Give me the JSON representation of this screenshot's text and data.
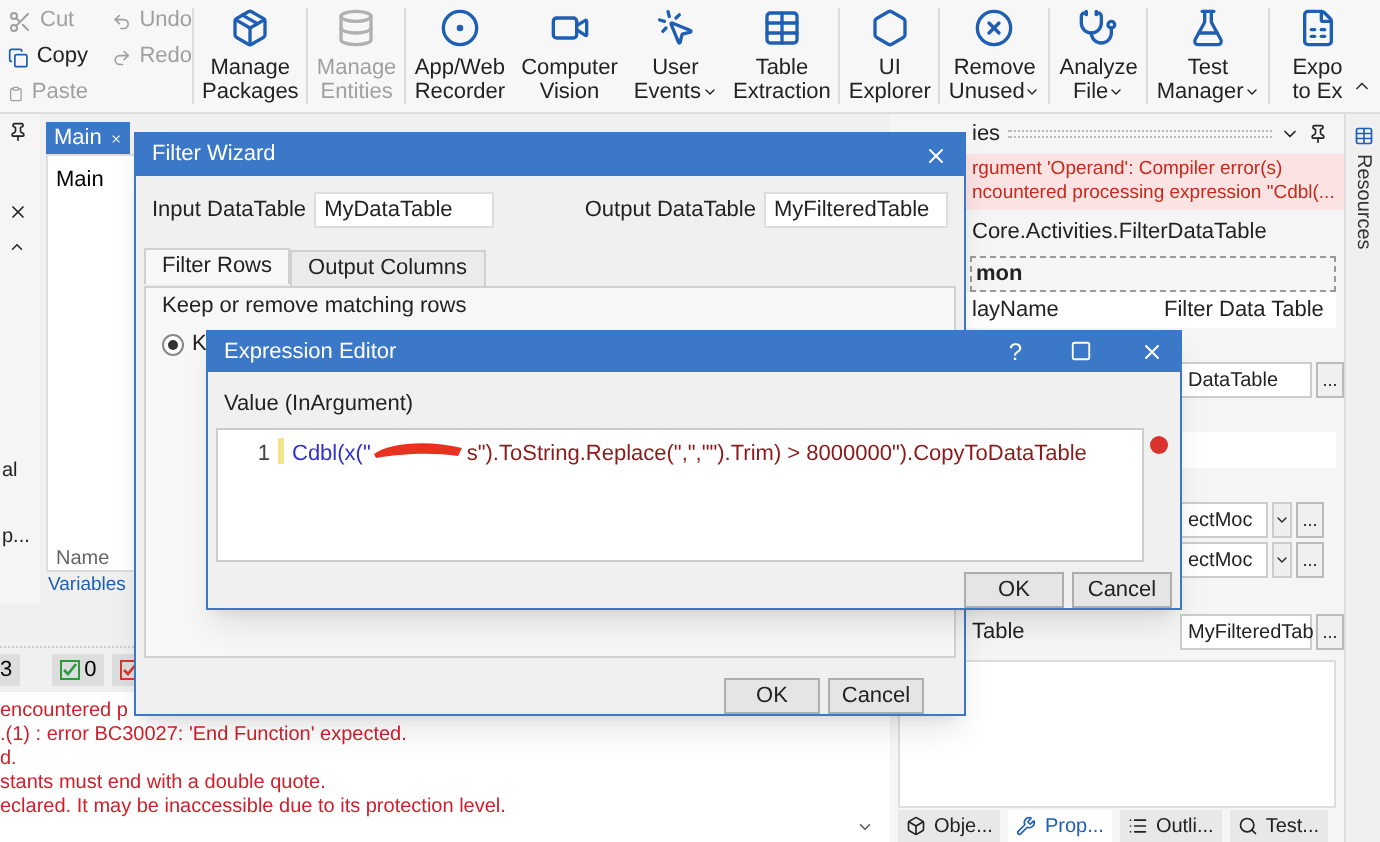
{
  "ribbon": {
    "clipboard": [
      {
        "kind": "cut",
        "label": "Cut",
        "disabled": true
      },
      {
        "kind": "undo",
        "label": "Undo",
        "disabled": true
      },
      {
        "kind": "copy",
        "label": "Copy",
        "disabled": false
      },
      {
        "kind": "redo",
        "label": "Redo",
        "disabled": true
      },
      {
        "kind": "paste",
        "label": "Paste",
        "disabled": true
      }
    ],
    "buttons": [
      {
        "kind": "packages",
        "lines": [
          "Manage",
          "Packages"
        ],
        "disabled": false,
        "dropdown": false
      },
      {
        "kind": "entities",
        "lines": [
          "Manage",
          "Entities"
        ],
        "disabled": true,
        "dropdown": false
      },
      {
        "kind": "recorder",
        "lines": [
          "App/Web",
          "Recorder"
        ],
        "disabled": false,
        "dropdown": false
      },
      {
        "kind": "vision",
        "lines": [
          "Computer",
          "Vision"
        ],
        "disabled": false,
        "dropdown": false
      },
      {
        "kind": "events",
        "lines": [
          "User",
          "Events"
        ],
        "disabled": false,
        "dropdown": true
      },
      {
        "kind": "table",
        "lines": [
          "Table",
          "Extraction"
        ],
        "disabled": false,
        "dropdown": false
      },
      {
        "kind": "explorer",
        "lines": [
          "UI",
          "Explorer"
        ],
        "disabled": false,
        "dropdown": false
      },
      {
        "kind": "remove",
        "lines": [
          "Remove",
          "Unused"
        ],
        "disabled": false,
        "dropdown": true
      },
      {
        "kind": "analyze",
        "lines": [
          "Analyze",
          "File"
        ],
        "disabled": false,
        "dropdown": true
      },
      {
        "kind": "test",
        "lines": [
          "Test",
          "Manager"
        ],
        "disabled": false,
        "dropdown": true
      },
      {
        "kind": "export",
        "lines": [
          "Expo",
          "to Ex"
        ],
        "disabled": false,
        "dropdown": false
      }
    ]
  },
  "left_panel": {
    "texts": [
      "al",
      "p..."
    ]
  },
  "document": {
    "tab": {
      "label": "Main",
      "selected": true
    },
    "breadcrumb": "Main",
    "variables_header": "Name",
    "bottom_link": "Variables"
  },
  "output": {
    "counts": [
      {
        "kind": "plain",
        "label": "3"
      },
      {
        "kind": "success",
        "label": "0"
      },
      {
        "kind": "failure"
      }
    ],
    "lines": [
      "encountered p",
      ".(1) : error BC30027: 'End Function' expected.",
      "d.",
      "stants must end with a double quote.",
      "eclared. It may be inaccessible due to its protection level."
    ]
  },
  "properties": {
    "header": "ies",
    "error_lines": [
      "rgument 'Operand': Compiler error(s)",
      "ncountered processing expression \"Cdbl(..."
    ],
    "activity_type": "Core.Activities.FilterDataTable",
    "category": "mon",
    "rows": [
      {
        "kind": "text",
        "name": "layName",
        "value": "Filter Data Table"
      },
      {
        "kind": "section"
      },
      {
        "kind": "field",
        "value": "DataTable",
        "ellipsis": "..."
      },
      {
        "kind": "section"
      },
      {
        "kind": "blank"
      },
      {
        "kind": "section"
      },
      {
        "kind": "dropdown",
        "value": "ectMoc",
        "ellipsis": "..."
      },
      {
        "kind": "dropdown",
        "value": "ectMoc",
        "ellipsis": "..."
      },
      {
        "kind": "section"
      },
      {
        "kind": "field",
        "name": "Table",
        "value": "MyFilteredTab",
        "ellipsis": "..."
      }
    ],
    "tabs": [
      {
        "kind": "objects",
        "label": "Obje...",
        "selected": false
      },
      {
        "kind": "properties",
        "label": "Prop...",
        "selected": true
      },
      {
        "kind": "outline",
        "label": "Outli...",
        "selected": false
      },
      {
        "kind": "test",
        "label": "Test...",
        "selected": false
      }
    ]
  },
  "resources_label": "Resources",
  "filter_wizard": {
    "title": "Filter Wizard",
    "input_label": "Input DataTable",
    "input_value": "MyDataTable",
    "output_label": "Output DataTable",
    "output_value": "MyFilteredTable",
    "tabs": [
      {
        "label": "Filter Rows",
        "selected": true
      },
      {
        "label": "Output Columns",
        "selected": false
      }
    ],
    "mode_label": "Keep or remove matching rows",
    "radio": {
      "label": "K",
      "selected": true
    },
    "buttons": [
      "OK",
      "Cancel"
    ]
  },
  "expression_editor": {
    "title": "Expression Editor",
    "help": "?",
    "value_label": "Value (InArgument)",
    "line_number": "1",
    "code_before": "Cdbl(x(\"",
    "code_after": "s\").ToString.Replace(\",\",\"\").Trim) > 8000000\").CopyToDataTable",
    "has_error": true,
    "buttons": [
      "OK",
      "Cancel"
    ]
  }
}
